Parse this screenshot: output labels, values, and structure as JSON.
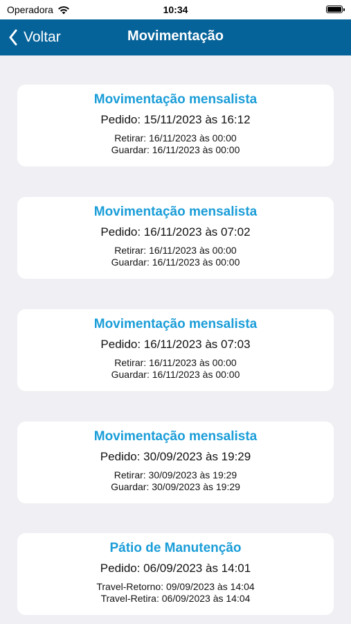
{
  "status_bar": {
    "carrier": "Operadora",
    "time": "10:34"
  },
  "nav": {
    "back_label": "Voltar",
    "title": "Movimentação"
  },
  "cards": [
    {
      "title": "Movimentação mensalista",
      "order": "Pedido: 15/11/2023 às 16:12",
      "line1": "Retirar: 16/11/2023 às 00:00",
      "line2": "Guardar: 16/11/2023 às 00:00"
    },
    {
      "title": "Movimentação mensalista",
      "order": "Pedido: 16/11/2023 às 07:02",
      "line1": "Retirar: 16/11/2023 às 00:00",
      "line2": "Guardar: 16/11/2023 às 00:00"
    },
    {
      "title": "Movimentação mensalista",
      "order": "Pedido: 16/11/2023 às 07:03",
      "line1": "Retirar: 16/11/2023 às 00:00",
      "line2": "Guardar: 16/11/2023 às 00:00"
    },
    {
      "title": "Movimentação mensalista",
      "order": "Pedido: 30/09/2023 às 19:29",
      "line1": "Retirar: 30/09/2023 às 19:29",
      "line2": "Guardar: 30/09/2023 às 19:29"
    },
    {
      "title": "Pátio de Manutenção",
      "order": "Pedido: 06/09/2023 às 14:01",
      "line1": "Travel-Retorno: 09/09/2023 às 14:04",
      "line2": "Travel-Retira: 06/09/2023 às 14:04"
    }
  ],
  "colors": {
    "nav_background": "#06639a",
    "card_title": "#1a9dd8",
    "page_background": "#f0f0f4"
  },
  "icons": {
    "wifi": "wifi-icon",
    "battery": "battery-icon",
    "back": "chevron-left-icon"
  }
}
